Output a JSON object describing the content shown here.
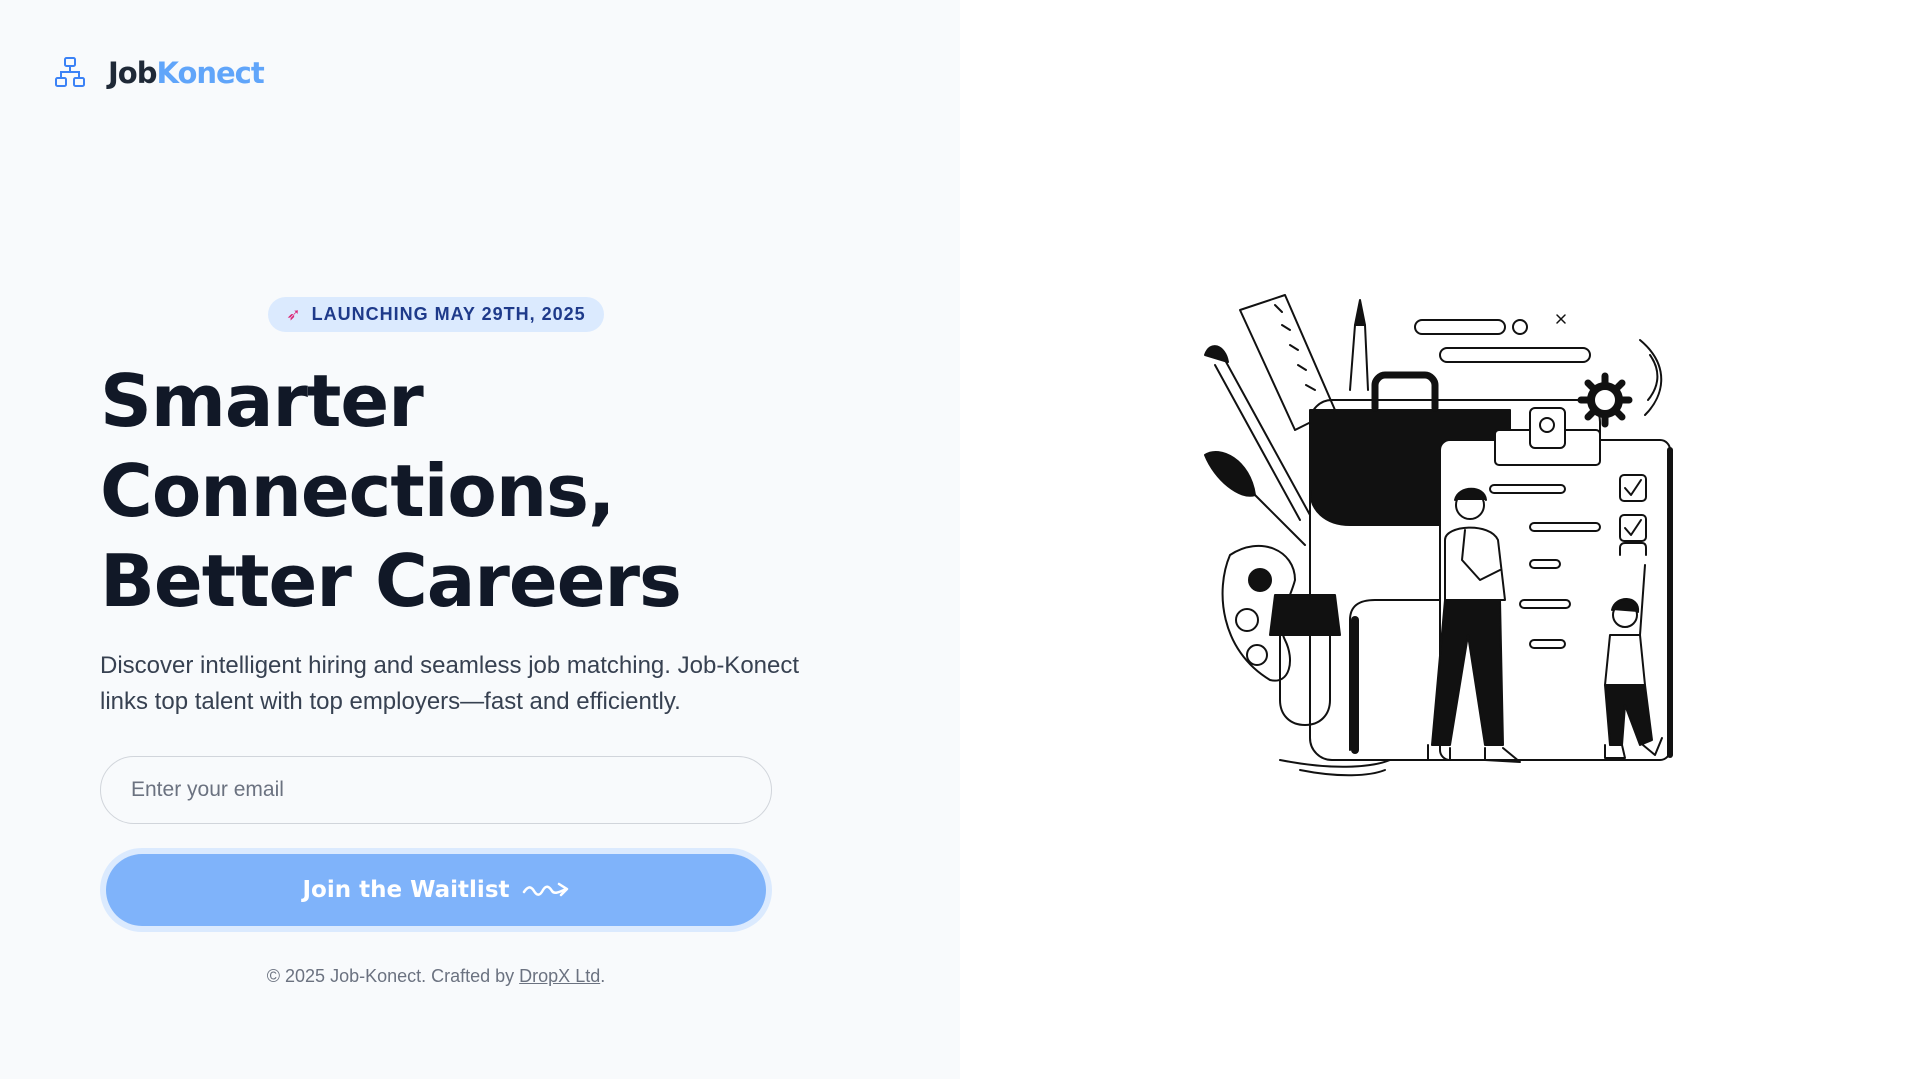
{
  "brand": {
    "name_part1": "Job",
    "name_part2": "Konect",
    "brand_color": "#60a5fa"
  },
  "hero": {
    "badge_icon": "rocket-icon",
    "badge": "LAUNCHING MAY 29TH, 2025",
    "headline_line1": "Smarter Connections,",
    "headline_line2": "Better Careers",
    "subtitle": "Discover intelligent hiring and seamless job matching. Job-Konect links top talent with top employers—fast and efficiently."
  },
  "form": {
    "email_placeholder": "Enter your email",
    "email_value": "",
    "submit_label": "Join the Waitlist",
    "submit_icon": "squiggle-arrow-icon"
  },
  "footer": {
    "text": "© 2025 Job-Konect. Crafted by ",
    "link_text": "DropX Ltd",
    "suffix": "."
  },
  "colors": {
    "button": "#7fb3fa",
    "badge_bg": "#dbeafe",
    "badge_text": "#1e3a8a",
    "left_panel_bg": "#f8fafc"
  }
}
